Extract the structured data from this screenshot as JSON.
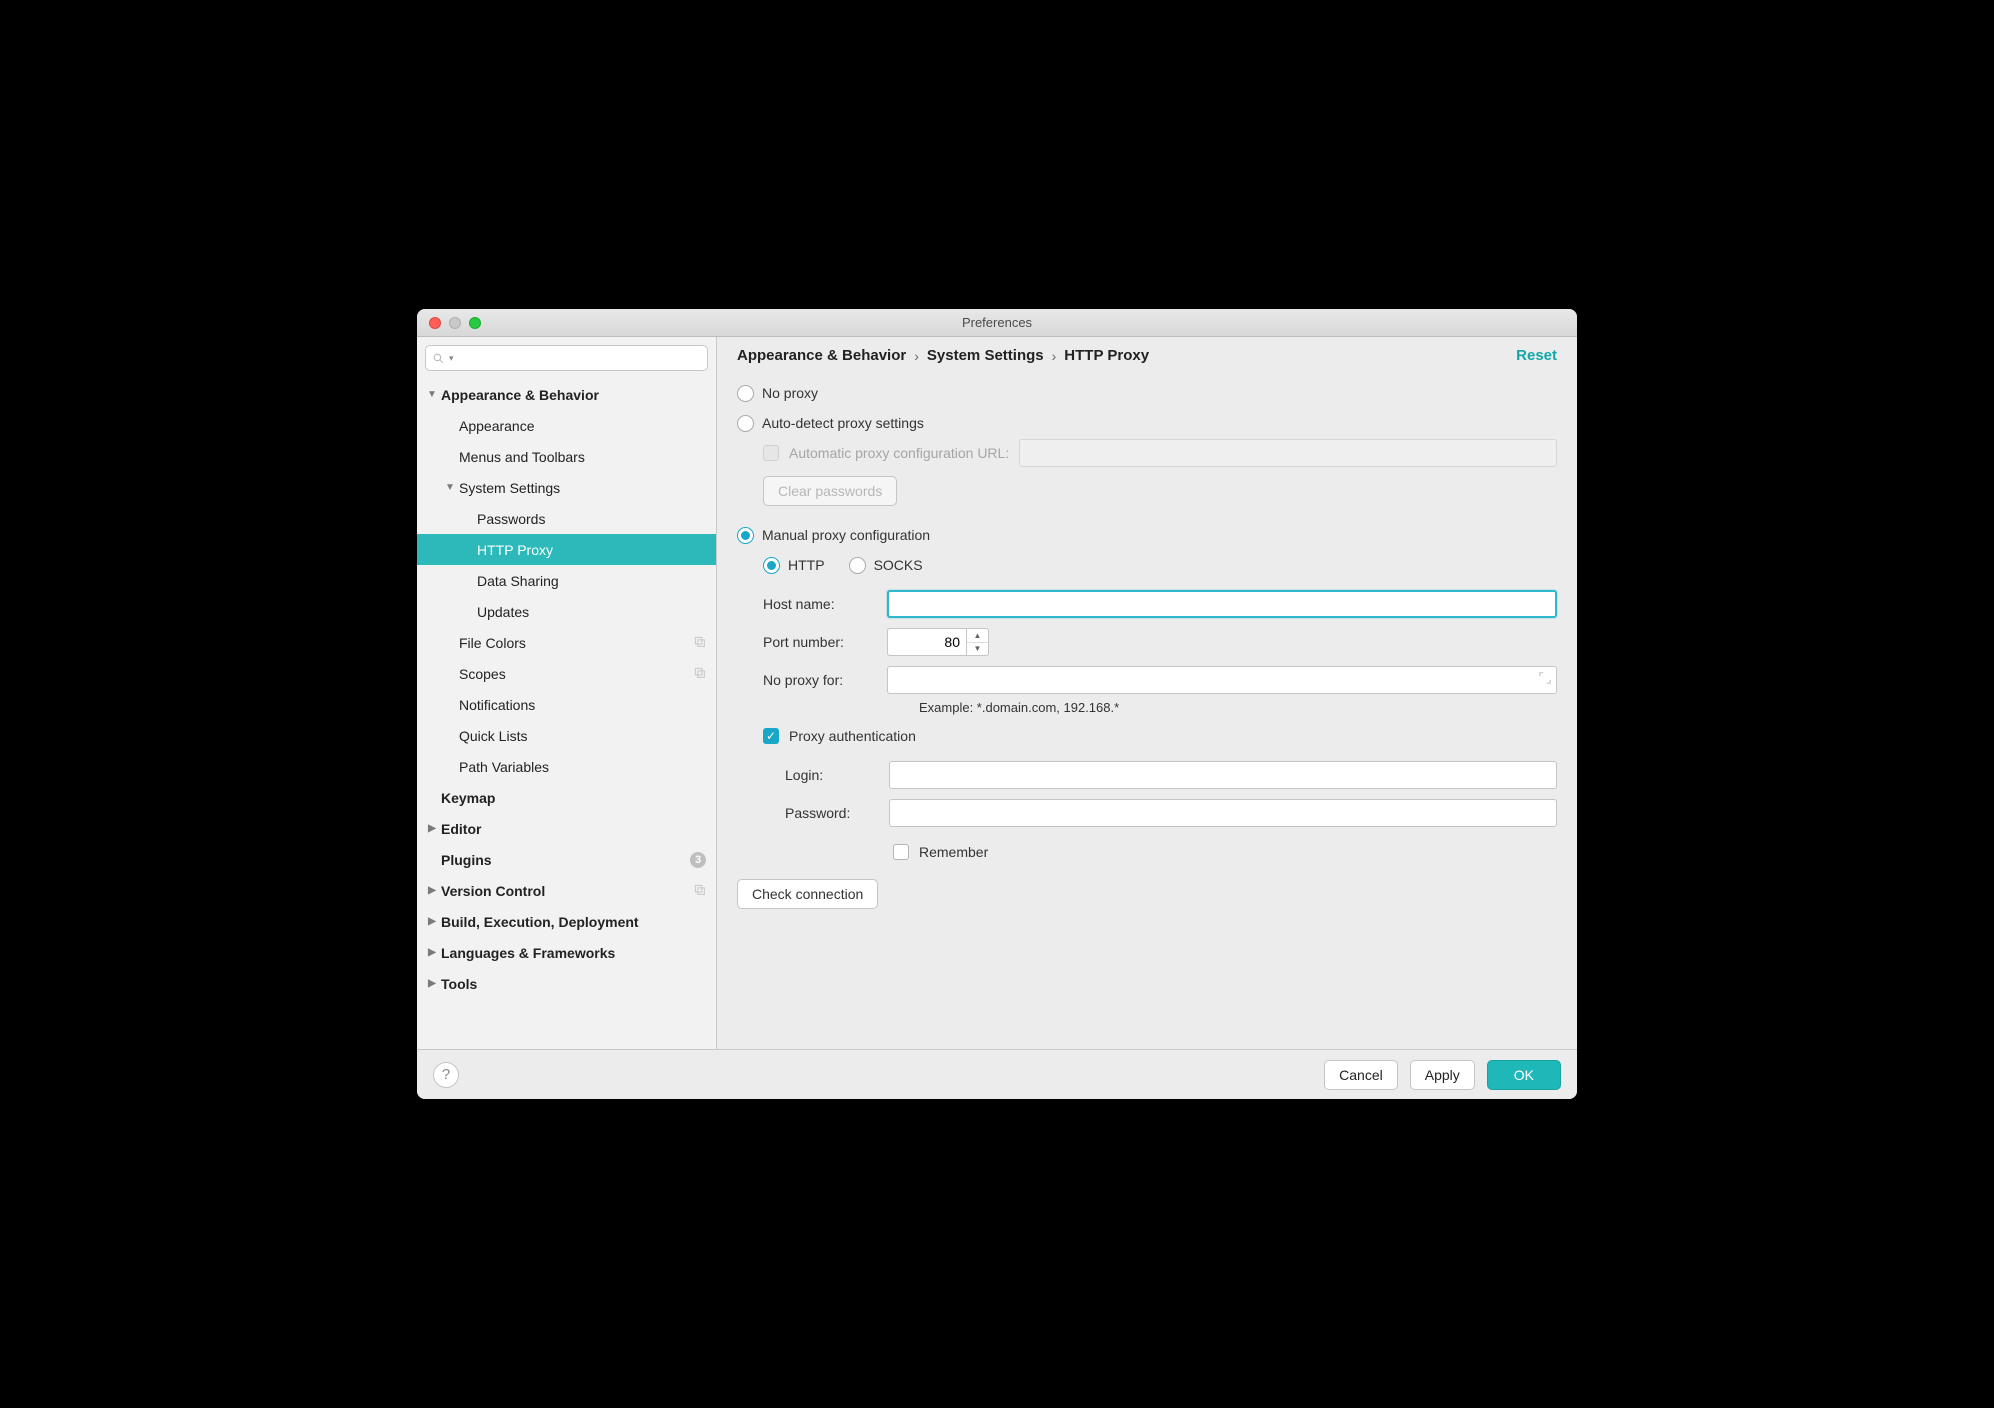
{
  "window": {
    "title": "Preferences"
  },
  "search": {
    "placeholder": ""
  },
  "sidebar": {
    "items": [
      {
        "label": "Appearance & Behavior",
        "bold": true,
        "disclosure": "down",
        "indent": 0
      },
      {
        "label": "Appearance",
        "indent": 1
      },
      {
        "label": "Menus and Toolbars",
        "indent": 1
      },
      {
        "label": "System Settings",
        "disclosure": "down",
        "indent": 1
      },
      {
        "label": "Passwords",
        "indent": 2
      },
      {
        "label": "HTTP Proxy",
        "indent": 2,
        "selected": true
      },
      {
        "label": "Data Sharing",
        "indent": 2
      },
      {
        "label": "Updates",
        "indent": 2
      },
      {
        "label": "File Colors",
        "indent": 1,
        "copy": true
      },
      {
        "label": "Scopes",
        "indent": 1,
        "copy": true
      },
      {
        "label": "Notifications",
        "indent": 1
      },
      {
        "label": "Quick Lists",
        "indent": 1
      },
      {
        "label": "Path Variables",
        "indent": 1
      },
      {
        "label": "Keymap",
        "bold": true,
        "indent": 0
      },
      {
        "label": "Editor",
        "bold": true,
        "disclosure": "right",
        "indent": 0
      },
      {
        "label": "Plugins",
        "bold": true,
        "indent": 0,
        "badge": "3"
      },
      {
        "label": "Version Control",
        "bold": true,
        "disclosure": "right",
        "indent": 0,
        "copy": true
      },
      {
        "label": "Build, Execution, Deployment",
        "bold": true,
        "disclosure": "right",
        "indent": 0
      },
      {
        "label": "Languages & Frameworks",
        "bold": true,
        "disclosure": "right",
        "indent": 0
      },
      {
        "label": "Tools",
        "bold": true,
        "disclosure": "right",
        "indent": 0
      }
    ]
  },
  "breadcrumb": {
    "a": "Appearance & Behavior",
    "b": "System Settings",
    "c": "HTTP Proxy",
    "reset": "Reset"
  },
  "proxy": {
    "no_proxy": "No proxy",
    "auto_detect": "Auto-detect proxy settings",
    "auto_url_label": "Automatic proxy configuration URL:",
    "clear_pw": "Clear passwords",
    "manual": "Manual proxy configuration",
    "http": "HTTP",
    "socks": "SOCKS",
    "host_label": "Host name:",
    "host_value": "",
    "port_label": "Port number:",
    "port_value": "80",
    "no_proxy_for_label": "No proxy for:",
    "no_proxy_for_value": "",
    "example": "Example: *.domain.com, 192.168.*",
    "proxy_auth": "Proxy authentication",
    "login_label": "Login:",
    "login_value": "",
    "password_label": "Password:",
    "password_value": "",
    "remember": "Remember",
    "check": "Check connection"
  },
  "footer": {
    "cancel": "Cancel",
    "apply": "Apply",
    "ok": "OK"
  }
}
